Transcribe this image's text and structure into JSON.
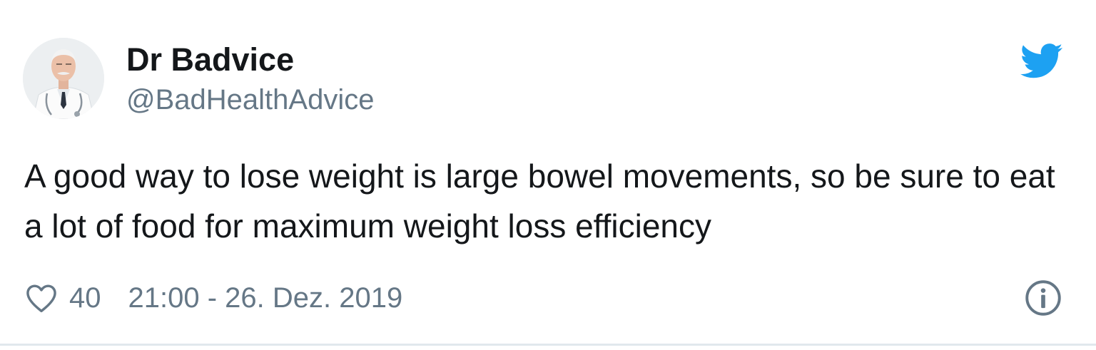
{
  "tweet": {
    "author": {
      "display_name": "Dr Badvice",
      "handle": "@BadHealthAdvice"
    },
    "text": "A good way to lose weight is large bowel movements, so be sure to eat a lot of food for maximum weight loss efficiency",
    "likes": "40",
    "timestamp": "21:00 - 26. Dez. 2019"
  },
  "icons": {
    "brand": "twitter-bird-icon",
    "like": "heart-outline-icon",
    "info": "info-circle-icon"
  },
  "colors": {
    "brand_blue": "#1da1f2",
    "text_primary": "#14171a",
    "text_secondary": "#657786",
    "divider": "#e1e8ed"
  }
}
